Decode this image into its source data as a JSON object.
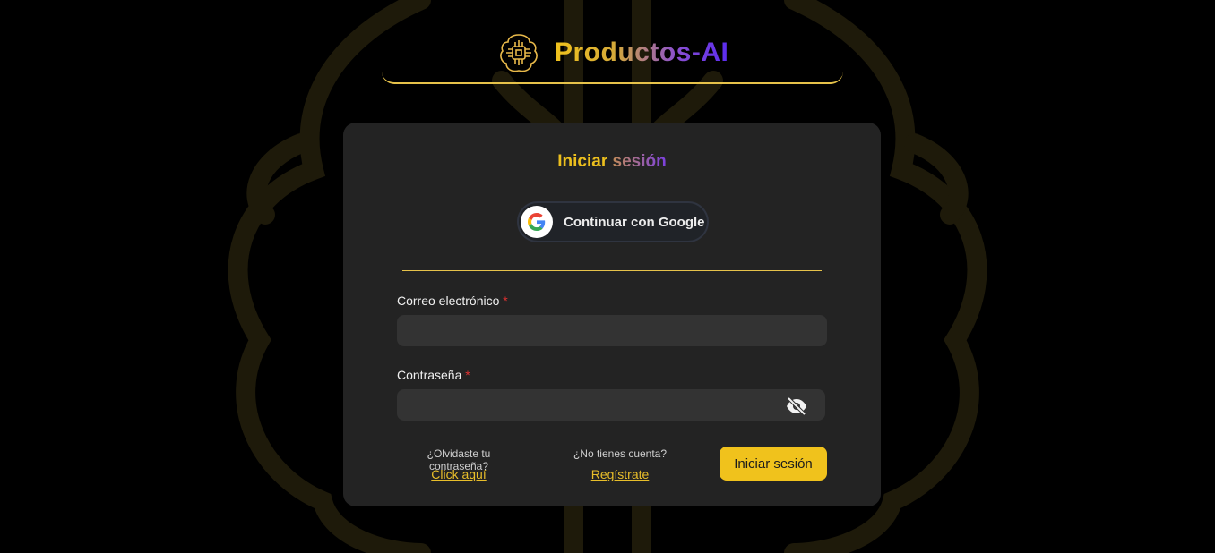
{
  "brand": {
    "name": "Productos-AI",
    "logo_icon": "brain-chip-icon"
  },
  "colors": {
    "accent_yellow": "#f0c21c",
    "accent_purple": "#5b2cf0",
    "card_bg": "#232323",
    "page_bg": "#000000"
  },
  "login": {
    "title_part1": "Iniciar",
    "title_part2": "sesión",
    "google_label": "Continuar con Google",
    "email_label": "Correo electrónico",
    "password_label": "Contraseña",
    "required_mark": "*",
    "email_value": "",
    "password_value": "",
    "forgot_hint": "¿Olvidaste tu contraseña?",
    "forgot_link": "Click aquí",
    "register_hint": "¿No tienes cuenta?",
    "register_link": "Regístrate",
    "submit_label": "Iniciar sesión"
  }
}
